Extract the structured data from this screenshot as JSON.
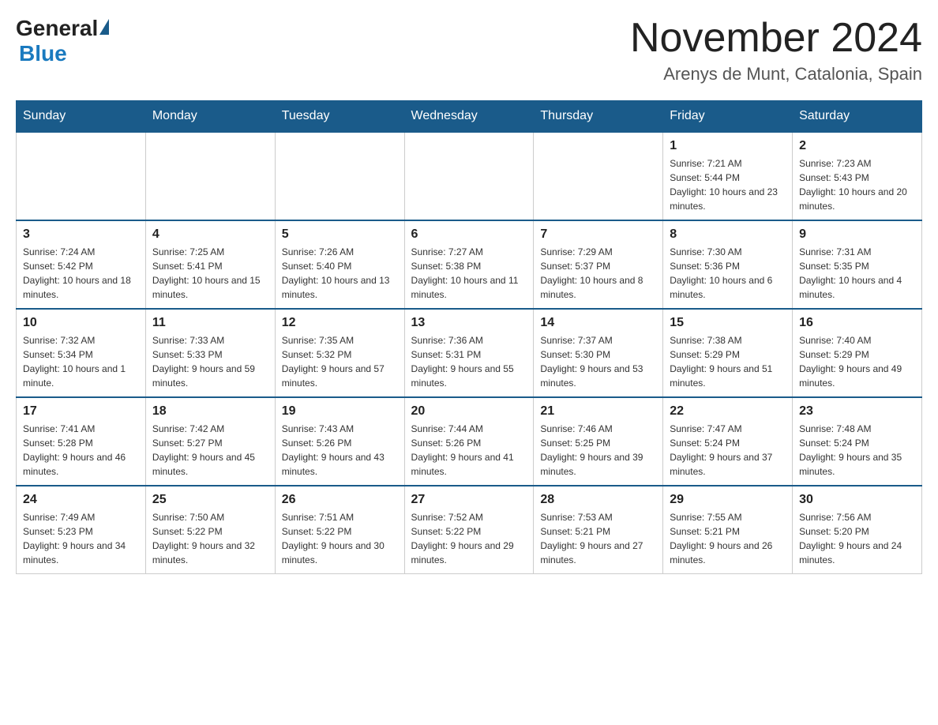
{
  "header": {
    "logo_general": "General",
    "logo_blue": "Blue",
    "title": "November 2024",
    "subtitle": "Arenys de Munt, Catalonia, Spain"
  },
  "weekdays": [
    "Sunday",
    "Monday",
    "Tuesday",
    "Wednesday",
    "Thursday",
    "Friday",
    "Saturday"
  ],
  "weeks": [
    [
      {
        "day": "",
        "info": ""
      },
      {
        "day": "",
        "info": ""
      },
      {
        "day": "",
        "info": ""
      },
      {
        "day": "",
        "info": ""
      },
      {
        "day": "",
        "info": ""
      },
      {
        "day": "1",
        "info": "Sunrise: 7:21 AM\nSunset: 5:44 PM\nDaylight: 10 hours and 23 minutes."
      },
      {
        "day": "2",
        "info": "Sunrise: 7:23 AM\nSunset: 5:43 PM\nDaylight: 10 hours and 20 minutes."
      }
    ],
    [
      {
        "day": "3",
        "info": "Sunrise: 7:24 AM\nSunset: 5:42 PM\nDaylight: 10 hours and 18 minutes."
      },
      {
        "day": "4",
        "info": "Sunrise: 7:25 AM\nSunset: 5:41 PM\nDaylight: 10 hours and 15 minutes."
      },
      {
        "day": "5",
        "info": "Sunrise: 7:26 AM\nSunset: 5:40 PM\nDaylight: 10 hours and 13 minutes."
      },
      {
        "day": "6",
        "info": "Sunrise: 7:27 AM\nSunset: 5:38 PM\nDaylight: 10 hours and 11 minutes."
      },
      {
        "day": "7",
        "info": "Sunrise: 7:29 AM\nSunset: 5:37 PM\nDaylight: 10 hours and 8 minutes."
      },
      {
        "day": "8",
        "info": "Sunrise: 7:30 AM\nSunset: 5:36 PM\nDaylight: 10 hours and 6 minutes."
      },
      {
        "day": "9",
        "info": "Sunrise: 7:31 AM\nSunset: 5:35 PM\nDaylight: 10 hours and 4 minutes."
      }
    ],
    [
      {
        "day": "10",
        "info": "Sunrise: 7:32 AM\nSunset: 5:34 PM\nDaylight: 10 hours and 1 minute."
      },
      {
        "day": "11",
        "info": "Sunrise: 7:33 AM\nSunset: 5:33 PM\nDaylight: 9 hours and 59 minutes."
      },
      {
        "day": "12",
        "info": "Sunrise: 7:35 AM\nSunset: 5:32 PM\nDaylight: 9 hours and 57 minutes."
      },
      {
        "day": "13",
        "info": "Sunrise: 7:36 AM\nSunset: 5:31 PM\nDaylight: 9 hours and 55 minutes."
      },
      {
        "day": "14",
        "info": "Sunrise: 7:37 AM\nSunset: 5:30 PM\nDaylight: 9 hours and 53 minutes."
      },
      {
        "day": "15",
        "info": "Sunrise: 7:38 AM\nSunset: 5:29 PM\nDaylight: 9 hours and 51 minutes."
      },
      {
        "day": "16",
        "info": "Sunrise: 7:40 AM\nSunset: 5:29 PM\nDaylight: 9 hours and 49 minutes."
      }
    ],
    [
      {
        "day": "17",
        "info": "Sunrise: 7:41 AM\nSunset: 5:28 PM\nDaylight: 9 hours and 46 minutes."
      },
      {
        "day": "18",
        "info": "Sunrise: 7:42 AM\nSunset: 5:27 PM\nDaylight: 9 hours and 45 minutes."
      },
      {
        "day": "19",
        "info": "Sunrise: 7:43 AM\nSunset: 5:26 PM\nDaylight: 9 hours and 43 minutes."
      },
      {
        "day": "20",
        "info": "Sunrise: 7:44 AM\nSunset: 5:26 PM\nDaylight: 9 hours and 41 minutes."
      },
      {
        "day": "21",
        "info": "Sunrise: 7:46 AM\nSunset: 5:25 PM\nDaylight: 9 hours and 39 minutes."
      },
      {
        "day": "22",
        "info": "Sunrise: 7:47 AM\nSunset: 5:24 PM\nDaylight: 9 hours and 37 minutes."
      },
      {
        "day": "23",
        "info": "Sunrise: 7:48 AM\nSunset: 5:24 PM\nDaylight: 9 hours and 35 minutes."
      }
    ],
    [
      {
        "day": "24",
        "info": "Sunrise: 7:49 AM\nSunset: 5:23 PM\nDaylight: 9 hours and 34 minutes."
      },
      {
        "day": "25",
        "info": "Sunrise: 7:50 AM\nSunset: 5:22 PM\nDaylight: 9 hours and 32 minutes."
      },
      {
        "day": "26",
        "info": "Sunrise: 7:51 AM\nSunset: 5:22 PM\nDaylight: 9 hours and 30 minutes."
      },
      {
        "day": "27",
        "info": "Sunrise: 7:52 AM\nSunset: 5:22 PM\nDaylight: 9 hours and 29 minutes."
      },
      {
        "day": "28",
        "info": "Sunrise: 7:53 AM\nSunset: 5:21 PM\nDaylight: 9 hours and 27 minutes."
      },
      {
        "day": "29",
        "info": "Sunrise: 7:55 AM\nSunset: 5:21 PM\nDaylight: 9 hours and 26 minutes."
      },
      {
        "day": "30",
        "info": "Sunrise: 7:56 AM\nSunset: 5:20 PM\nDaylight: 9 hours and 24 minutes."
      }
    ]
  ]
}
